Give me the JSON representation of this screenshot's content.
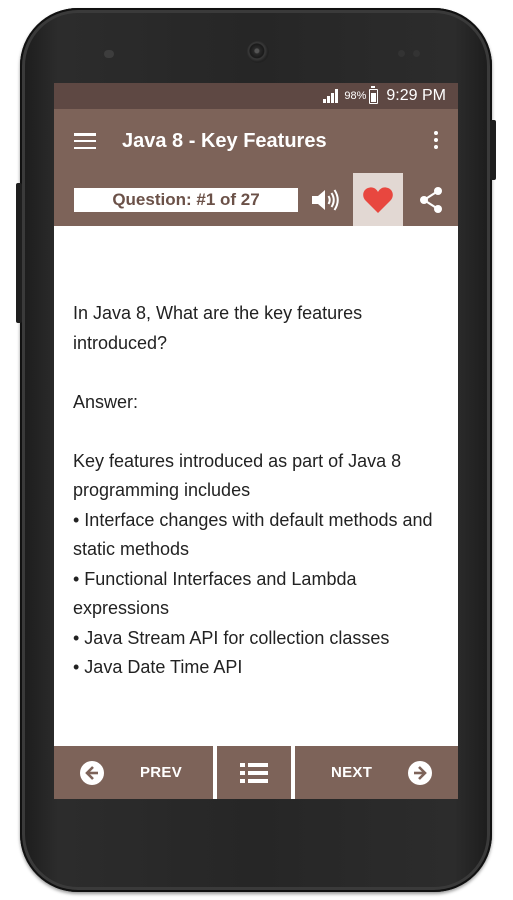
{
  "status_bar": {
    "battery_percent": "98%",
    "time": "9:29 PM"
  },
  "app_bar": {
    "title": "Java 8 - Key Features"
  },
  "question_bar": {
    "question_label": "Question: #1 of 27",
    "favorite_color": "#e8473f"
  },
  "content": {
    "question": "In Java 8, What are the key features introduced?",
    "answer_heading": "Answer:",
    "answer_intro": "Key features introduced as part of Java 8 programming includes",
    "answer_points": [
      "• Interface changes with default methods and static methods",
      "• Functional Interfaces and Lambda expressions",
      "• Java Stream API for collection classes",
      "• Java Date Time API"
    ]
  },
  "bottom_nav": {
    "prev_label": "PREV",
    "next_label": "NEXT"
  },
  "colors": {
    "primary": "#7d6359",
    "status_bar": "#5e4843",
    "favorite_bg": "#e2d8d3"
  },
  "icons": [
    "menu-icon",
    "overflow-menu-icon",
    "speaker-icon",
    "heart-icon",
    "share-icon",
    "arrow-left-circle-icon",
    "list-icon",
    "arrow-right-circle-icon"
  ]
}
